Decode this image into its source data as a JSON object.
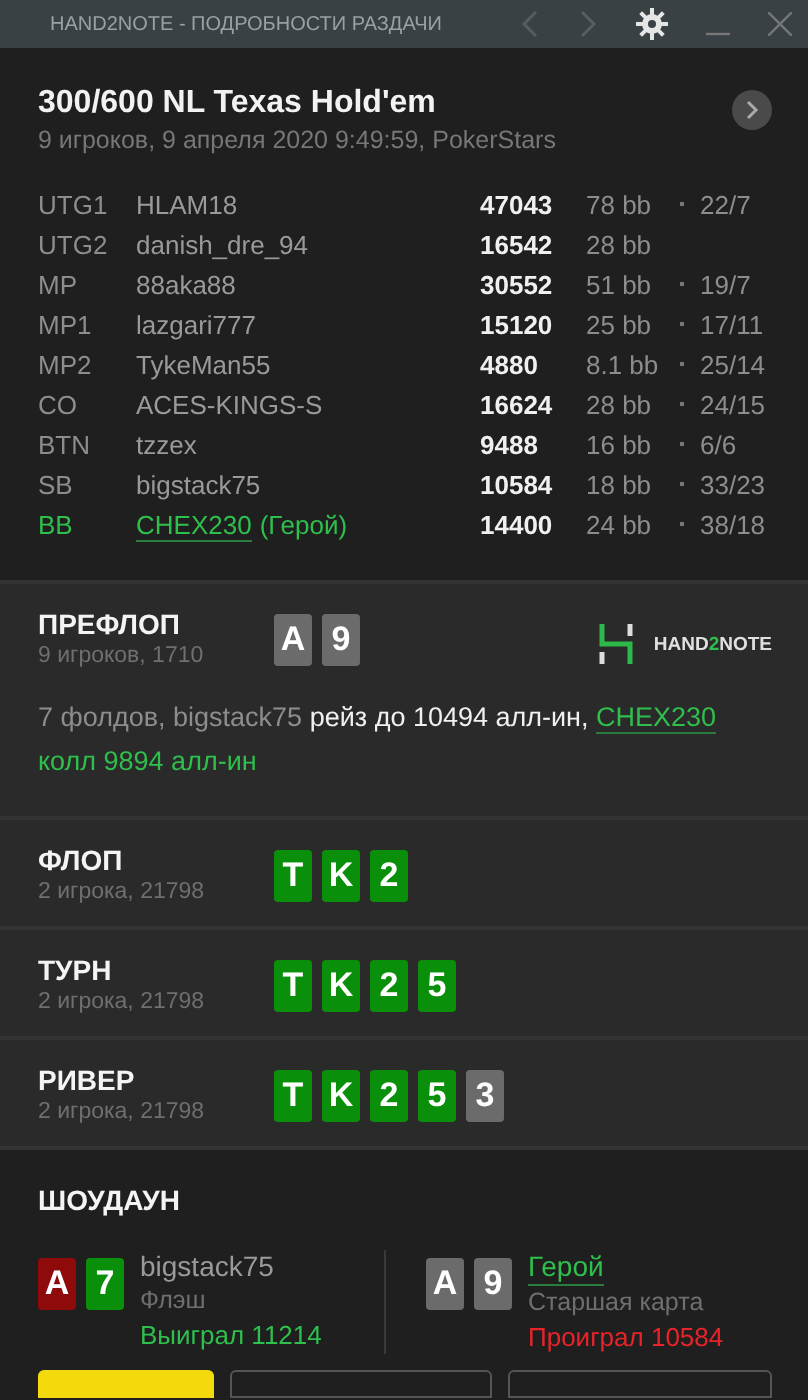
{
  "window": {
    "title": "HAND2NOTE - ПОДРОБНОСТИ РАЗДАЧИ",
    "nav_back_disabled": true,
    "nav_forward_disabled": true
  },
  "header": {
    "title": "300/600 NL Texas Hold'em",
    "subtitle": "9 игроков, 9 апреля 2020 9:49:59, PokerStars"
  },
  "players": [
    {
      "position": "UTG1",
      "name": "HLAM18",
      "hero": false,
      "stack": "47043",
      "bb": "78 bb",
      "ratio": "22/7"
    },
    {
      "position": "UTG2",
      "name": "danish_dre_94",
      "hero": false,
      "stack": "16542",
      "bb": "28 bb"
    },
    {
      "position": "MP",
      "name": "88aka88",
      "hero": false,
      "stack": "30552",
      "bb": "51 bb",
      "ratio": "19/7"
    },
    {
      "position": "MP1",
      "name": "lazgari777",
      "hero": false,
      "stack": "15120",
      "bb": "25 bb",
      "ratio": "17/11"
    },
    {
      "position": "MP2",
      "name": "TykeMan55",
      "hero": false,
      "stack": "4880",
      "bb": "8.1 bb",
      "ratio": "25/14"
    },
    {
      "position": "CO",
      "name": "ACES-KINGS-S",
      "hero": false,
      "stack": "16624",
      "bb": "28 bb",
      "ratio": "24/15"
    },
    {
      "position": "BTN",
      "name": "tzzex",
      "hero": false,
      "stack": "9488",
      "bb": "16 bb",
      "ratio": "6/6"
    },
    {
      "position": "SB",
      "name": "bigstack75",
      "hero": false,
      "stack": "10584",
      "bb": "18 bb",
      "ratio": "33/23"
    },
    {
      "position": "BB",
      "name": "CHEX230",
      "hero": true,
      "hero_tag": "(Герой)",
      "stack": "14400",
      "bb": "24 bb",
      "ratio": "38/18"
    }
  ],
  "streets": [
    {
      "name": "ПРЕФЛОП",
      "info": "9 игроков, 1710",
      "cards": [
        {
          "rank": "A",
          "color": "#6b6b6b"
        },
        {
          "rank": "9",
          "color": "#6b6b6b"
        }
      ],
      "logo": {
        "text_a": "HAND",
        "text_b": "2",
        "text_c": "NOTE"
      },
      "action": [
        {
          "kind": "plain",
          "text": "7 фолдов, bigstack75"
        },
        {
          "kind": "action",
          "text": "рейз до 10494 алл-ин,"
        },
        {
          "kind": "hero",
          "text": "CHEX230"
        },
        {
          "kind": "hero-action",
          "text": "колл 9894 алл-ин"
        }
      ]
    },
    {
      "name": "ФЛОП",
      "info": "2 игрока, 21798",
      "cards": [
        {
          "rank": "T",
          "color": "#0a8f0a"
        },
        {
          "rank": "K",
          "color": "#0a8f0a"
        },
        {
          "rank": "2",
          "color": "#0a8f0a"
        }
      ]
    },
    {
      "name": "ТУРН",
      "info": "2 игрока, 21798",
      "cards": [
        {
          "rank": "T",
          "color": "#0a8f0a"
        },
        {
          "rank": "K",
          "color": "#0a8f0a"
        },
        {
          "rank": "2",
          "color": "#0a8f0a"
        },
        {
          "rank": "5",
          "color": "#0a8f0a"
        }
      ]
    },
    {
      "name": "РИВЕР",
      "info": "2 игрока, 21798",
      "cards": [
        {
          "rank": "T",
          "color": "#0a8f0a"
        },
        {
          "rank": "K",
          "color": "#0a8f0a"
        },
        {
          "rank": "2",
          "color": "#0a8f0a"
        },
        {
          "rank": "5",
          "color": "#0a8f0a"
        },
        {
          "rank": "3",
          "color": "#6b6b6b"
        }
      ]
    }
  ],
  "showdown": {
    "title": "ШОУДАУН",
    "hands": [
      {
        "cards": [
          {
            "rank": "A",
            "color": "#8f0a0a"
          },
          {
            "rank": "7",
            "color": "#0a8f0a"
          }
        ],
        "player": "bigstack75",
        "hero": false,
        "combo": "Флэш",
        "result": "Выиграл 11214",
        "won": true
      },
      {
        "cards": [
          {
            "rank": "A",
            "color": "#6b6b6b"
          },
          {
            "rank": "9",
            "color": "#6b6b6b"
          }
        ],
        "player": "Герой",
        "hero": true,
        "combo": "Старшая карта",
        "result": "Проиграл 10584",
        "won": false
      }
    ]
  },
  "buttons": [
    {
      "kind": "primary"
    },
    {
      "kind": "outline"
    },
    {
      "kind": "outline"
    }
  ]
}
